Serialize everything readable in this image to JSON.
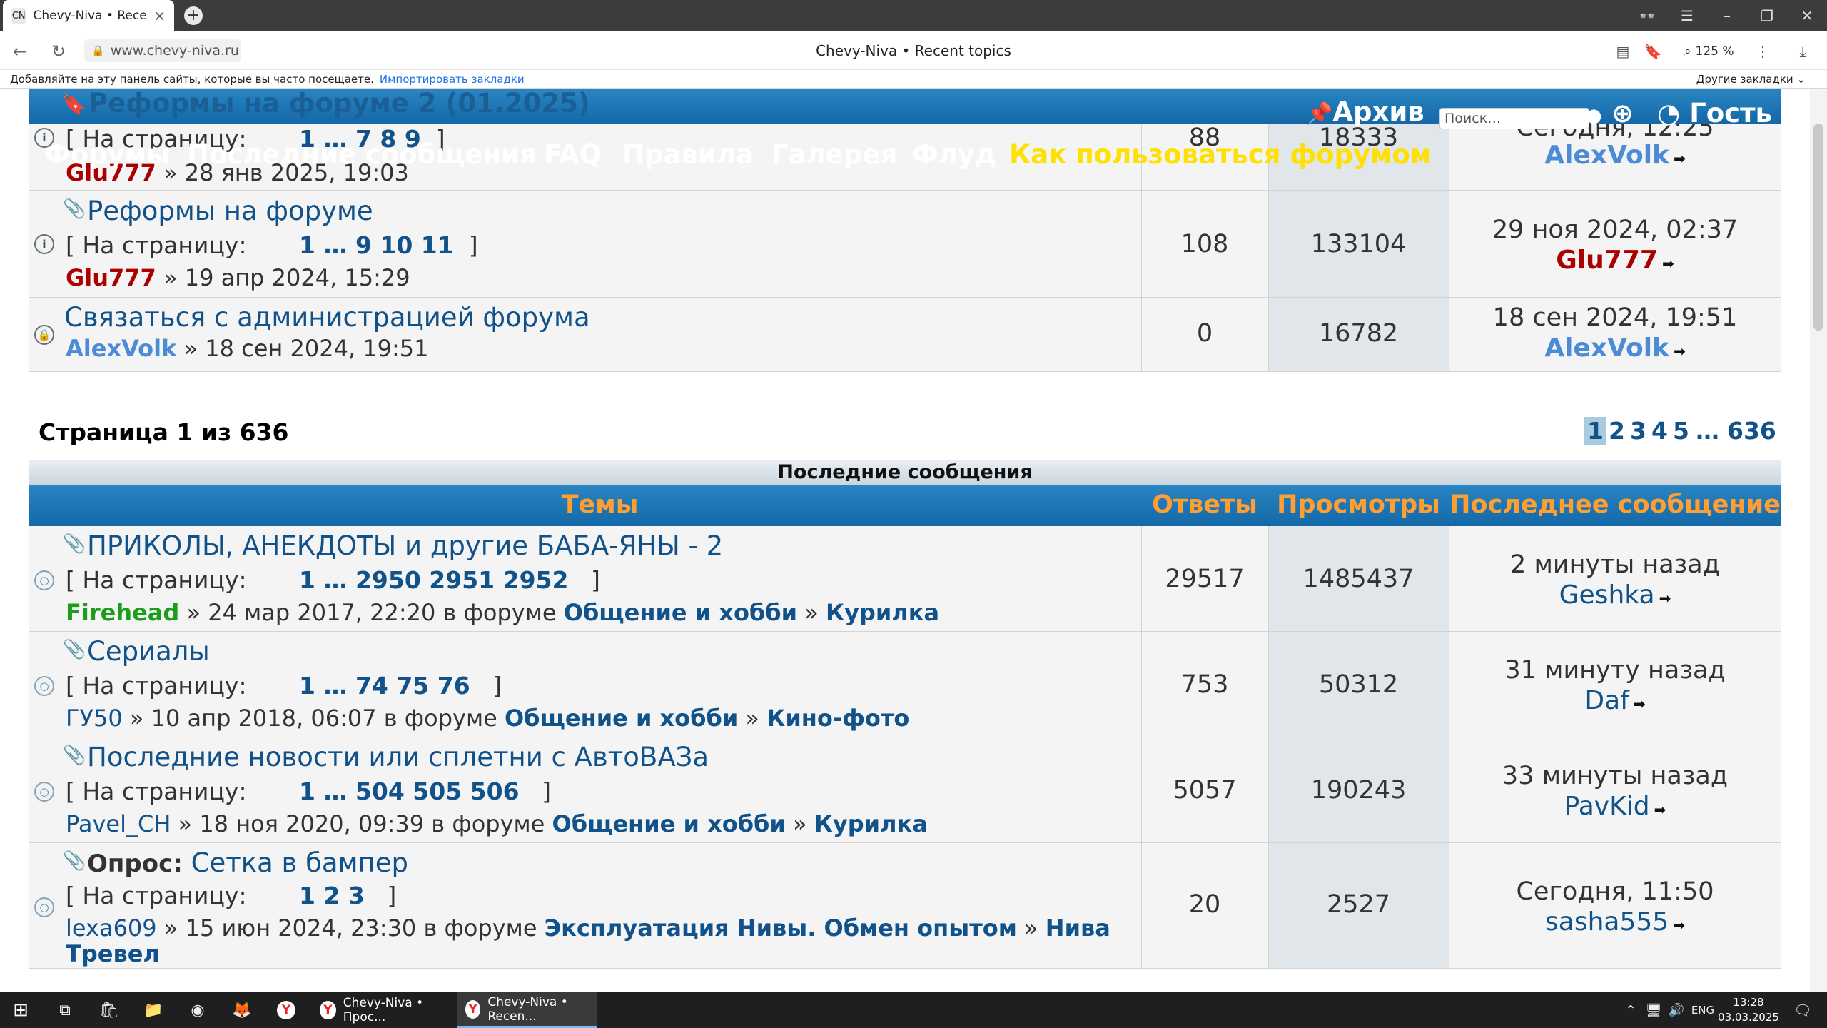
{
  "browser": {
    "tab1_title": "Chevy-Niva • Recent to",
    "tab1_favicon": "CN",
    "url": "www.chevy-niva.ru",
    "page_title": "Chevy-Niva • Recent topics",
    "zoom": "125 %",
    "bookmarks_text": "Добавляйте на эту панель сайты, которые вы часто посещаете.",
    "bookmarks_import": "Импортировать закладки",
    "bookmarks_other": "Другие закладки"
  },
  "nav": {
    "forums": "Форумы",
    "recent": "Последние сообщения",
    "faq": "FAQ",
    "rules": "Правила",
    "gallery": "Галерея",
    "flood": "Флуд",
    "howto": "Как пользоваться форумом",
    "archive": "Архив",
    "search_placeholder": "Поиск…",
    "guest": "Гость"
  },
  "announcements": [
    {
      "title": "Реформы на форуме 2 (01.2025)",
      "pages_prefix": "[ На страницу:",
      "pages": "1 … 7 8 9",
      "pages_suffix": "]",
      "author": "Glu777",
      "author_color": "#aa0000",
      "date": "» 28 янв 2025, 19:03",
      "replies": "88",
      "views": "18333",
      "last_time": "Сегодня, 12:25",
      "last_author": "AlexVolk",
      "last_color": "#4c8bd6"
    },
    {
      "title": "Реформы на форуме",
      "pages_prefix": "[ На страницу:",
      "pages": "1 … 9 10 11",
      "pages_suffix": "]",
      "author": "Glu777",
      "author_color": "#aa0000",
      "date": "» 19 апр 2024, 15:29",
      "replies": "108",
      "views": "133104",
      "last_time": "29 ноя 2024, 02:37",
      "last_author": "Glu777",
      "last_color": "#aa0000"
    },
    {
      "title": "Связаться с администрацией форума",
      "author": "AlexVolk",
      "author_color": "#4c8bd6",
      "date": "» 18 сен 2024, 19:51",
      "replies": "0",
      "views": "16782",
      "last_time": "18 сен 2024, 19:51",
      "last_author": "AlexVolk",
      "last_color": "#4c8bd6"
    }
  ],
  "pagination": {
    "label": "Страница 1 из 636",
    "p1": "1",
    "p2": "2",
    "p3": "3",
    "p4": "4",
    "p5": "5",
    "ellipsis": "…",
    "last": "636"
  },
  "recent": {
    "heading": "Последние сообщения",
    "col_topics": "Темы",
    "col_replies": "Ответы",
    "col_views": "Просмотры",
    "col_last": "Последнее сообщение",
    "in_forum": "в форуме",
    "sep": "»"
  },
  "topics": [
    {
      "title": "ПРИКОЛЫ, АНЕКДОТЫ и другие БАБА-ЯНЫ - 2",
      "pages_prefix": "[ На страницу:",
      "pages": "1 … 2950 2951 2952",
      "pages_suffix": "]",
      "author": "Firehead",
      "author_color": "#1b9e1b",
      "date": "» 24 мар 2017, 22:20",
      "forum1": "Общение и хобби",
      "forum2": "Курилка",
      "replies": "29517",
      "views": "1485437",
      "last_time": "2 минуты назад",
      "last_author": "Geshka",
      "last_color": "#105289"
    },
    {
      "title": "Сериалы",
      "pages_prefix": "[ На страницу:",
      "pages": "1 … 74 75 76",
      "pages_suffix": "]",
      "author": "ГУ50",
      "author_color": "#105289",
      "date": "» 10 апр 2018, 06:07",
      "forum1": "Общение и хобби",
      "forum2": "Кино-фото",
      "replies": "753",
      "views": "50312",
      "last_time": "31 минуту назад",
      "last_author": "Daf",
      "last_color": "#105289"
    },
    {
      "title": "Последние новости или сплетни с АвтоВАЗа",
      "pages_prefix": "[ На страницу:",
      "pages": "1 … 504 505 506",
      "pages_suffix": "]",
      "author": "Pavel_CH",
      "author_color": "#105289",
      "date": "» 18 ноя 2020, 09:39",
      "forum1": "Общение и хобби",
      "forum2": "Курилка",
      "replies": "5057",
      "views": "190243",
      "last_time": "33 минуты назад",
      "last_author": "PavKid",
      "last_color": "#105289"
    },
    {
      "poll_label": "Опрос:",
      "title": "Сетка в бампер",
      "pages_prefix": "[ На страницу:",
      "pages": "1 2 3",
      "pages_suffix": "]",
      "author": "lexa609",
      "author_color": "#105289",
      "date": "» 15 июн 2024, 23:30",
      "forum1": "Эксплуатация Нивы. Обмен опытом",
      "forum2": "Нива",
      "forum2_cont": "Тревел",
      "replies": "20",
      "views": "2527",
      "last_time": "Сегодня, 11:50",
      "last_author": "sasha555",
      "last_color": "#105289"
    }
  ],
  "taskbar": {
    "app1": "Chevy-Niva • Прос...",
    "app2": "Chevy-Niva • Recen...",
    "lang": "ENG",
    "time": "13:28",
    "date": "03.03.2025"
  },
  "colors": {
    "header_blue": "#1a74b4",
    "link": "#105289",
    "col_head_text": "#ff9e32",
    "howto": "#ffe000"
  }
}
